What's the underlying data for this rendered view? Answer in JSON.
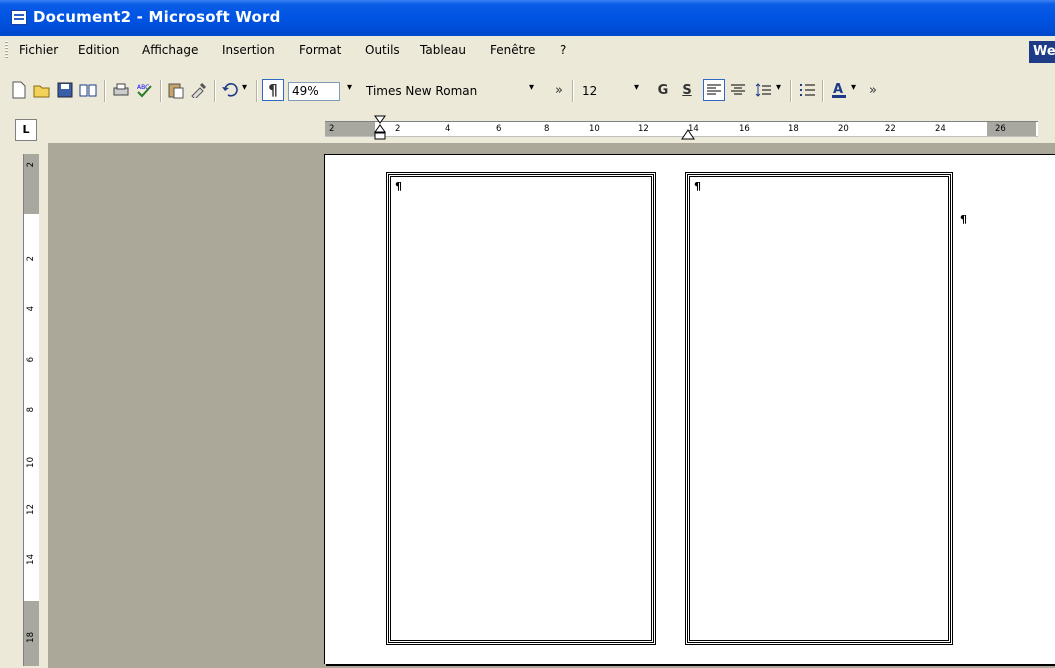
{
  "window": {
    "title": "Document2 - Microsoft Word"
  },
  "menu": {
    "items": [
      "Fichier",
      "Edition",
      "Affichage",
      "Insertion",
      "Format",
      "Outils",
      "Tableau",
      "Fenêtre",
      "?"
    ],
    "help_box": "We"
  },
  "toolbar": {
    "zoom": "49%",
    "font": "Times New Roman",
    "size": "12",
    "bold": "G",
    "underline": "S",
    "overflow": "»"
  },
  "ruler": {
    "tab_selector": "L",
    "h_ticks": [
      "2",
      "2",
      "4",
      "6",
      "8",
      "10",
      "12",
      "14",
      "16",
      "18",
      "20",
      "22",
      "24",
      "26"
    ],
    "v_ticks": [
      "2",
      "2",
      "4",
      "6",
      "8",
      "10",
      "12",
      "14",
      "18"
    ]
  },
  "document": {
    "paragraph_mark": "¶"
  },
  "icons": {
    "new": "new-document-icon",
    "open": "open-folder-icon",
    "save": "save-icon",
    "book": "research-icon",
    "print": "print-icon",
    "spell": "spellcheck-icon",
    "paste": "paste-icon",
    "brush": "format-painter-icon",
    "undo": "undo-icon",
    "pilcrow": "show-formatting-icon",
    "align_left": "align-left-icon",
    "align_center": "align-center-icon",
    "line_spacing": "line-spacing-icon",
    "bullets": "bullets-icon",
    "font_color": "font-color-icon"
  }
}
